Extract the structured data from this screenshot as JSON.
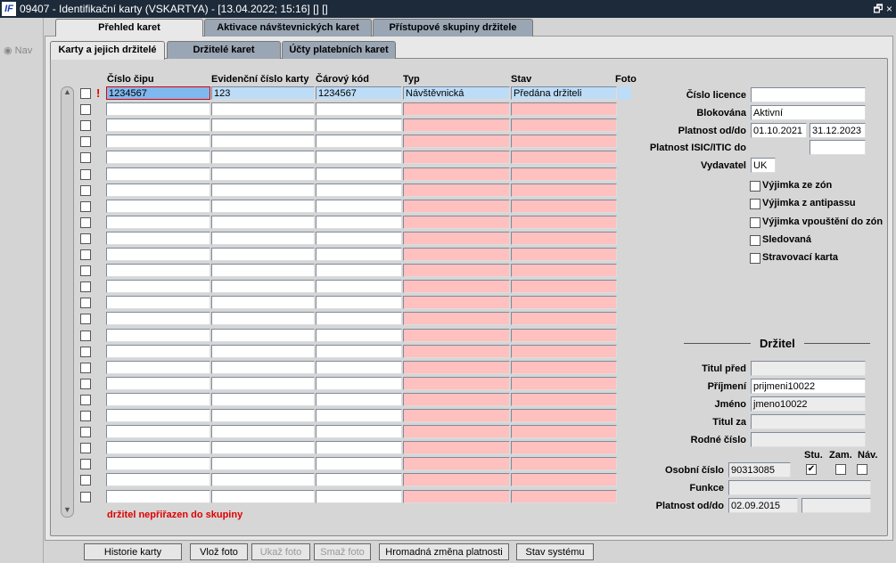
{
  "window": {
    "title": "09407 - Identifikační karty (VSKARTYA) - [13.04.2022; 15:16]  [] []",
    "logo": "IF",
    "restore_icon": "restore-icon"
  },
  "nav": {
    "label": "Nav"
  },
  "outer_tabs": [
    "Přehled karet",
    "Aktivace návštevnických karet",
    "Přístupové skupiny držitele"
  ],
  "inner_tabs": [
    "Karty a jejich držitelé",
    "Držitelé karet",
    "Účty platebních karet"
  ],
  "grid": {
    "columns": [
      "Číslo čipu",
      "Evidenční číslo karty",
      "Čárový kód",
      "Typ",
      "Stav",
      "Foto"
    ],
    "rows": [
      {
        "marker": "!",
        "cislo_cipu": "1234567",
        "evidencni": "123",
        "carovy": "1234567",
        "typ": "Návštěvnická",
        "stav": "Předána držiteli"
      }
    ],
    "empty_rows": 25,
    "message": "držitel nepřiřazen do skupiny"
  },
  "card": {
    "cislo_licence_label": "Číslo licence",
    "cislo_licence": "",
    "blokovana_label": "Blokována",
    "blokovana": "Aktivní",
    "platnost_label": "Platnost od/do",
    "platnost_od": "01.10.2021",
    "platnost_do": "31.12.2023",
    "isic_label": "Platnost ISIC/ITIC do",
    "isic": "",
    "vydavatel_label": "Vydavatel",
    "vydavatel": "UK",
    "checkboxes": [
      {
        "label": "Výjimka ze zón",
        "checked": false
      },
      {
        "label": "Výjimka z antipassu",
        "checked": false
      },
      {
        "label": "Výjimka vpouštění do zón",
        "checked": false
      },
      {
        "label": "Sledovaná",
        "checked": false
      },
      {
        "label": "Stravovací karta",
        "checked": false
      }
    ]
  },
  "holder": {
    "section": "Držitel",
    "titul_pred_label": "Titul před",
    "titul_pred": "",
    "prijmeni_label": "Příjmení",
    "prijmeni": "prijmeni10022",
    "jmeno_label": "Jméno",
    "jmeno": "jmeno10022",
    "titul_za_label": "Titul za",
    "titul_za": "",
    "rodne_label": "Rodné číslo",
    "rodne": "",
    "osobni_label": "Osobní číslo",
    "osobni": "90313085",
    "stu_label": "Stu.",
    "zam_label": "Zam.",
    "nav_label": "Náv.",
    "stu": true,
    "zam": false,
    "nav": false,
    "funkce_label": "Funkce",
    "funkce": "",
    "platnost_label": "Platnost od/do",
    "platnost_od": "02.09.2015",
    "platnost_do": ""
  },
  "buttons": [
    "Historie karty",
    "Vlož foto",
    "Ukaž foto",
    "Smaž foto",
    "Hromadná změna platnosti",
    "Stav systému"
  ]
}
